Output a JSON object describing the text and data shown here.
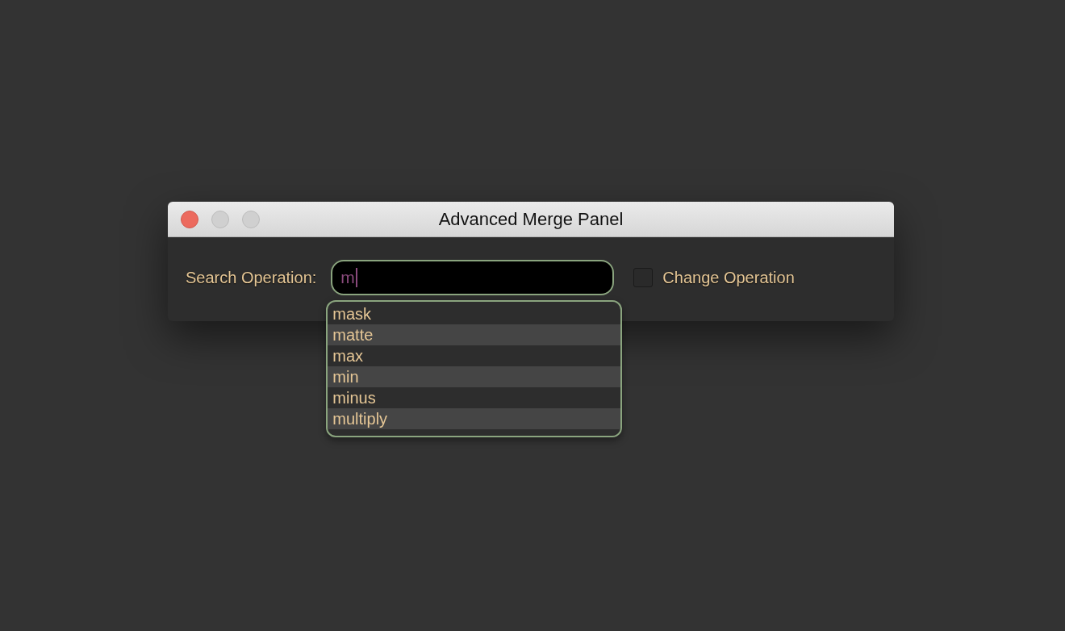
{
  "window": {
    "title": "Advanced Merge Panel"
  },
  "search": {
    "label": "Search Operation:",
    "value": "m"
  },
  "change_operation": {
    "label": "Change Operation",
    "checked": false
  },
  "suggestions": [
    {
      "label": "mask"
    },
    {
      "label": "matte"
    },
    {
      "label": "max"
    },
    {
      "label": "min"
    },
    {
      "label": "minus"
    },
    {
      "label": "multiply"
    }
  ]
}
